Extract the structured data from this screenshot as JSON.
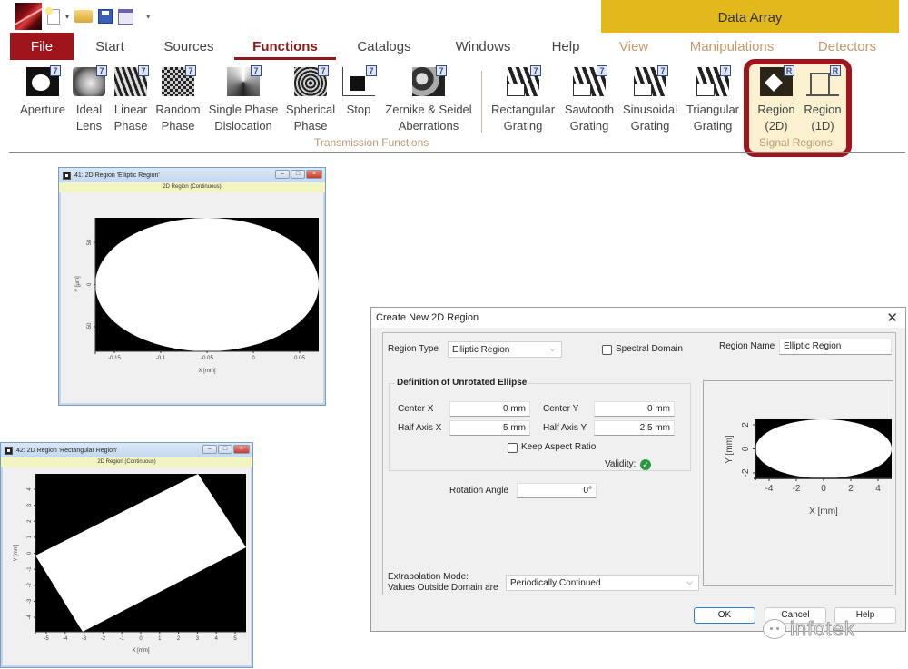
{
  "quick_access": {
    "icons": [
      "app-logo",
      "new-file-icon",
      "dropdown-arrow-icon",
      "open-folder-icon",
      "save-icon",
      "calendar-icon",
      "customize-qat-icon"
    ]
  },
  "context_header": "Data Array",
  "tabs": [
    {
      "label": "File"
    },
    {
      "label": "Start"
    },
    {
      "label": "Sources"
    },
    {
      "label": "Functions",
      "active": true
    },
    {
      "label": "Catalogs"
    },
    {
      "label": "Windows"
    },
    {
      "label": "Help"
    },
    {
      "label": "View",
      "contextual": true
    },
    {
      "label": "Manipulations",
      "contextual": true
    },
    {
      "label": "Detectors",
      "contextual": true
    }
  ],
  "ribbon": {
    "transmission_functions": [
      {
        "line1": "Aperture",
        "line2": "",
        "icon": "aperture-icon"
      },
      {
        "line1": "Ideal",
        "line2": "Lens",
        "icon": "ideal-lens-icon"
      },
      {
        "line1": "Linear",
        "line2": "Phase",
        "icon": "linear-phase-icon"
      },
      {
        "line1": "Random",
        "line2": "Phase",
        "icon": "random-phase-icon"
      },
      {
        "line1": "Single Phase",
        "line2": "Dislocation",
        "icon": "phase-dislocation-icon"
      },
      {
        "line1": "Spherical",
        "line2": "Phase",
        "icon": "spherical-phase-icon"
      },
      {
        "line1": "Stop",
        "line2": "",
        "icon": "stop-icon"
      },
      {
        "line1": "Zernike & Seidel",
        "line2": "Aberrations",
        "icon": "zernike-icon"
      },
      {
        "line1": "Rectangular",
        "line2": "Grating",
        "icon": "rectangular-grating-icon"
      },
      {
        "line1": "Sawtooth",
        "line2": "Grating",
        "icon": "sawtooth-grating-icon"
      },
      {
        "line1": "Sinusoidal",
        "line2": "Grating",
        "icon": "sinusoidal-grating-icon"
      },
      {
        "line1": "Triangular",
        "line2": "Grating",
        "icon": "triangular-grating-icon"
      }
    ],
    "transmission_group_label": "Transmission Functions",
    "signal_regions": [
      {
        "line1": "Region",
        "line2": "(2D)",
        "icon": "region-2d-icon"
      },
      {
        "line1": "Region",
        "line2": "(1D)",
        "icon": "region-1d-icon"
      }
    ],
    "signal_group_label": "Signal Regions",
    "highlight_color": "#a0141c"
  },
  "window_elliptic": {
    "title": "41: 2D Region 'Elliptic Region'",
    "subtitle": "2D Region (Continuous)",
    "plot": {
      "xlabel": "X [mm]",
      "ylabel": "Y [µm]",
      "x_ticks": [
        "-0.15",
        "-0.1",
        "-0.05",
        "0",
        "0.05"
      ],
      "y_ticks": [
        "50",
        "0",
        "-50"
      ]
    }
  },
  "window_rectangular": {
    "title": "42: 2D Region 'Rectangular Region'",
    "subtitle": "2D Region (Continuous)",
    "plot": {
      "xlabel": "X [mm]",
      "ylabel": "Y [mm]",
      "x_ticks": [
        "-5",
        "-4",
        "-3",
        "-2",
        "-1",
        "0",
        "1",
        "2",
        "3",
        "4",
        "5"
      ],
      "y_ticks": [
        "4",
        "3",
        "2",
        "1",
        "0",
        "-1",
        "-2",
        "-3",
        "-4"
      ]
    }
  },
  "dialog": {
    "title": "Create New 2D Region",
    "region_type_label": "Region Type",
    "region_type_value": "Elliptic Region",
    "spectral_domain_label": "Spectral Domain",
    "spectral_domain_checked": false,
    "region_name_label": "Region Name",
    "region_name_value": "Elliptic Region",
    "group_title": "Definition of Unrotated Ellipse",
    "center_x_label": "Center X",
    "center_x_value": "0 mm",
    "center_y_label": "Center Y",
    "center_y_value": "0 mm",
    "half_axis_x_label": "Half Axis X",
    "half_axis_x_value": "5 mm",
    "half_axis_y_label": "Half Axis Y",
    "half_axis_y_value": "2.5 mm",
    "keep_aspect_label": "Keep Aspect Ratio",
    "keep_aspect_checked": false,
    "validity_label": "Validity:",
    "validity_status": "valid",
    "rotation_label": "Rotation Angle",
    "rotation_value": "0°",
    "preview": {
      "xlabel": "X [mm]",
      "ylabel": "Y [mm]",
      "x_ticks": [
        "-4",
        "-2",
        "0",
        "2",
        "4"
      ],
      "y_ticks": [
        "2",
        "0",
        "-2"
      ]
    },
    "extrapolation_label_1": "Extrapolation Mode:",
    "extrapolation_label_2": "Values Outside Domain are",
    "extrapolation_value": "Periodically Continued",
    "ok_label": "OK",
    "cancel_label": "Cancel",
    "help_label": "Help"
  },
  "watermark": "infotek"
}
